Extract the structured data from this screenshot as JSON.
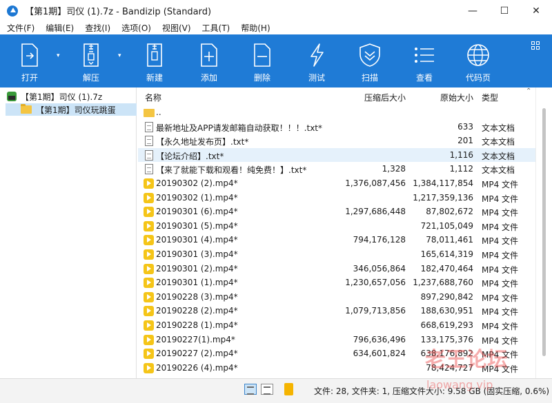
{
  "window": {
    "title": "【第1期】司仪 (1).7z - Bandizip (Standard)",
    "controls": [
      "—",
      "☐",
      "✕"
    ]
  },
  "menu": [
    "文件(F)",
    "编辑(E)",
    "查找(I)",
    "选项(O)",
    "视图(V)",
    "工具(T)",
    "帮助(H)"
  ],
  "toolbar": {
    "buttons": [
      {
        "label": "打开",
        "icon": "open-file-icon"
      },
      {
        "label": "解压",
        "icon": "extract-icon"
      },
      {
        "label": "新建",
        "icon": "new-archive-icon"
      },
      {
        "label": "添加",
        "icon": "add-file-icon"
      },
      {
        "label": "删除",
        "icon": "delete-file-icon"
      },
      {
        "label": "测试",
        "icon": "test-bolt-icon"
      },
      {
        "label": "扫描",
        "icon": "scan-shield-icon"
      },
      {
        "label": "查看",
        "icon": "view-list-icon"
      },
      {
        "label": "代码页",
        "icon": "codepage-globe-icon"
      }
    ],
    "dropdown_glyph": "▾",
    "accent": "#1f7bd6"
  },
  "tree": {
    "root": "【第1期】司仪 (1).7z",
    "child": "【第1期】司仪玩跳蛋"
  },
  "columns": {
    "name": "名称",
    "compressed": "压缩后大小",
    "original": "原始大小",
    "type": "类型",
    "sort_glyph": "⌃"
  },
  "files": [
    {
      "name": "..",
      "compressed": "",
      "original": "",
      "type": "",
      "icon": "folder"
    },
    {
      "name": "最新地址及APP请发邮箱自动获取！！！.txt*",
      "compressed": "",
      "original": "633",
      "type": "文本文档",
      "icon": "txt"
    },
    {
      "name": "【永久地址发布页】.txt*",
      "compressed": "",
      "original": "201",
      "type": "文本文档",
      "icon": "txt"
    },
    {
      "name": "【论坛介绍】.txt*",
      "compressed": "",
      "original": "1,116",
      "type": "文本文档",
      "icon": "txt",
      "selected": true
    },
    {
      "name": "【来了就能下载和观看！纯免费！】.txt*",
      "compressed": "1,328",
      "original": "1,112",
      "type": "文本文档",
      "icon": "txt"
    },
    {
      "name": "20190302 (2).mp4*",
      "compressed": "1,376,087,456",
      "original": "1,384,117,854",
      "type": "MP4 文件",
      "icon": "mp4"
    },
    {
      "name": "20190302 (1).mp4*",
      "compressed": "",
      "original": "1,217,359,136",
      "type": "MP4 文件",
      "icon": "mp4"
    },
    {
      "name": "20190301 (6).mp4*",
      "compressed": "1,297,686,448",
      "original": "87,802,672",
      "type": "MP4 文件",
      "icon": "mp4"
    },
    {
      "name": "20190301 (5).mp4*",
      "compressed": "",
      "original": "721,105,049",
      "type": "MP4 文件",
      "icon": "mp4"
    },
    {
      "name": "20190301 (4).mp4*",
      "compressed": "794,176,128",
      "original": "78,011,461",
      "type": "MP4 文件",
      "icon": "mp4"
    },
    {
      "name": "20190301 (3).mp4*",
      "compressed": "",
      "original": "165,614,319",
      "type": "MP4 文件",
      "icon": "mp4"
    },
    {
      "name": "20190301 (2).mp4*",
      "compressed": "346,056,864",
      "original": "182,470,464",
      "type": "MP4 文件",
      "icon": "mp4"
    },
    {
      "name": "20190301 (1).mp4*",
      "compressed": "1,230,657,056",
      "original": "1,237,688,760",
      "type": "MP4 文件",
      "icon": "mp4"
    },
    {
      "name": "20190228 (3).mp4*",
      "compressed": "",
      "original": "897,290,842",
      "type": "MP4 文件",
      "icon": "mp4"
    },
    {
      "name": "20190228 (2).mp4*",
      "compressed": "1,079,713,856",
      "original": "188,630,951",
      "type": "MP4 文件",
      "icon": "mp4"
    },
    {
      "name": "20190228 (1).mp4*",
      "compressed": "",
      "original": "668,619,293",
      "type": "MP4 文件",
      "icon": "mp4"
    },
    {
      "name": "20190227(1).mp4*",
      "compressed": "796,636,496",
      "original": "133,175,376",
      "type": "MP4 文件",
      "icon": "mp4"
    },
    {
      "name": "20190227 (2).mp4*",
      "compressed": "634,601,824",
      "original": "638,176,892",
      "type": "MP4 文件",
      "icon": "mp4"
    },
    {
      "name": "20190226 (4).mp4*",
      "compressed": "",
      "original": "78,424,727",
      "type": "MP4 文件",
      "icon": "mp4"
    }
  ],
  "status": {
    "text": "文件: 28, 文件夹: 1, 压缩文件大小: 9.58 GB (固实压缩, 0.6%)"
  },
  "watermark": {
    "main": "老王论坛",
    "sub": "laowang.vip"
  }
}
